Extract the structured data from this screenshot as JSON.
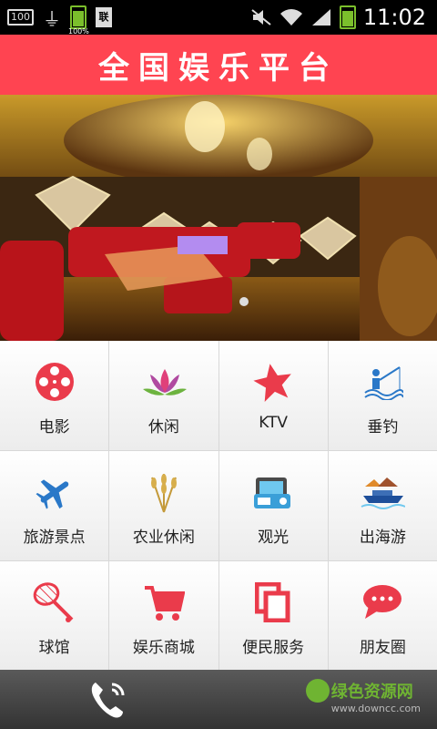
{
  "status_bar": {
    "notif_box": "100",
    "battery_small_label": "100%",
    "doc_icon_text": "联",
    "time": "11:02"
  },
  "header": {
    "title": "全国娱乐平台"
  },
  "grid": {
    "items": [
      {
        "label": "电影",
        "icon": "film-reel-icon"
      },
      {
        "label": "休闲",
        "icon": "lotus-icon"
      },
      {
        "label": "KTV",
        "icon": "star-icon"
      },
      {
        "label": "垂钓",
        "icon": "fishing-icon"
      },
      {
        "label": "旅游景点",
        "icon": "airplane-icon"
      },
      {
        "label": "农业休闲",
        "icon": "wheat-icon"
      },
      {
        "label": "观光",
        "icon": "camera-icon"
      },
      {
        "label": "出海游",
        "icon": "ship-icon"
      },
      {
        "label": "球馆",
        "icon": "badminton-icon"
      },
      {
        "label": "娱乐商城",
        "icon": "cart-icon"
      },
      {
        "label": "便民服务",
        "icon": "copy-pages-icon"
      },
      {
        "label": "朋友圈",
        "icon": "chat-bubble-icon"
      }
    ]
  },
  "watermark": {
    "text": "绿色资源网",
    "url": "www.downcc.com"
  },
  "colors": {
    "header_bg": "#ff4451",
    "icon_red": "#ea3b4b",
    "icon_blue": "#2a78c8"
  }
}
